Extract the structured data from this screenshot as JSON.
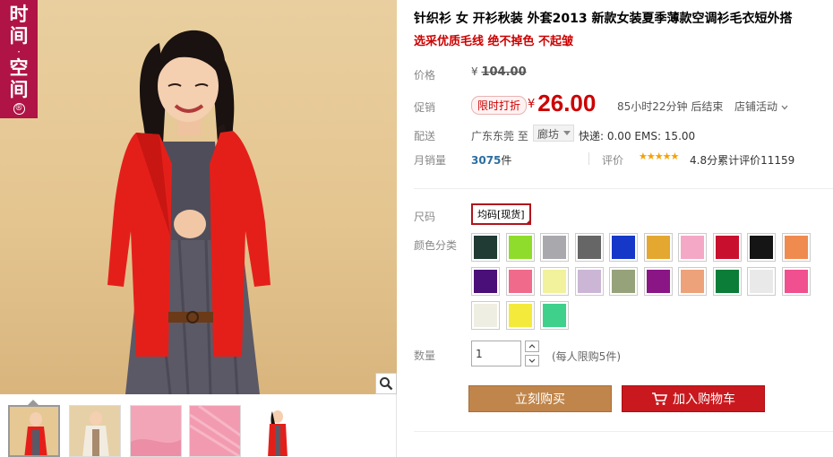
{
  "brand_tag": {
    "chars": [
      "时",
      "间",
      "·",
      "空",
      "间"
    ],
    "registered": "®"
  },
  "product": {
    "title": "针织衫 女 开衫秋装 外套2013 新款女装夏季薄款空调衫毛衣短外搭",
    "subtitle": "选采优质毛线 绝不掉色 不起皱"
  },
  "price": {
    "label": "价格",
    "currency": "¥",
    "original": "104.00"
  },
  "promo": {
    "label": "促销",
    "badge": "限时打折",
    "currency": "¥",
    "price": "26.00",
    "countdown": "85小时22分钟 后结束",
    "store_promo": "店铺活动"
  },
  "shipping": {
    "label": "配送",
    "from": "广东东莞 至",
    "destination": "廊坊",
    "fees": "快递: 0.00 EMS: 15.00"
  },
  "sales": {
    "label": "月销量",
    "count": "3075",
    "unit": "件",
    "rating_label": "评价",
    "stars": "★★★★★",
    "rating_text": "4.8分累计评价11159"
  },
  "size": {
    "label": "尺码",
    "selected": "均码[现货]"
  },
  "colors": {
    "label": "颜色分类",
    "swatches": [
      "#1f3b33",
      "#8fdc2c",
      "#a9a9ad",
      "#666666",
      "#1638c9",
      "#e4a830",
      "#f4a8c6",
      "#c8102e",
      "#151515",
      "#ef8b4f",
      "#4a0f78",
      "#f06a8c",
      "#f1f29b",
      "#cbb6d6",
      "#96a27a",
      "#8a1686",
      "#eea27a",
      "#0b7d38",
      "#e9e9e9",
      "#f0508f",
      "#efeee2",
      "#f4ea3c",
      "#3fd08c"
    ]
  },
  "quantity": {
    "label": "数量",
    "value": "1",
    "limit": "(每人限购5件)"
  },
  "buttons": {
    "buy": "立刻购买",
    "cart": "加入购物车"
  }
}
